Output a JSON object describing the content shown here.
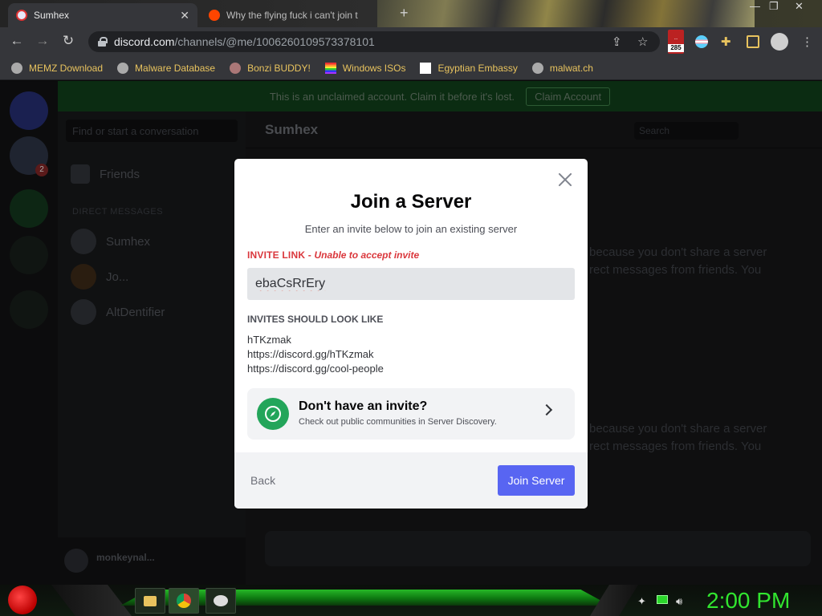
{
  "browser": {
    "tabs": [
      {
        "title": "Sumhex",
        "active": true
      },
      {
        "title": "Why the flying fuck i can't join t",
        "active": false
      }
    ],
    "url_host": "discord.com",
    "url_path": "/channels/@me/1006260109573378101",
    "extension_badge": "285",
    "bookmarks": [
      {
        "label": "MEMZ Download"
      },
      {
        "label": "Malware Database"
      },
      {
        "label": "Bonzi BUDDY!"
      },
      {
        "label": "Windows ISOs"
      },
      {
        "label": "Egyptian Embassy"
      },
      {
        "label": "malwat.ch"
      }
    ]
  },
  "discord": {
    "banner_text": "This is an unclaimed account. Claim it before it's lost.",
    "banner_button": "Claim Account",
    "search_placeholder": "Find or start a conversation",
    "friends_label": "Friends",
    "dm_header": "DIRECT MESSAGES",
    "dms": [
      {
        "name": "Sumhex"
      },
      {
        "name": "Jo..."
      },
      {
        "name": "AltDentifier"
      }
    ],
    "chat_title": "Sumhex",
    "header_search": "Search",
    "ghost_lines": [
      "because you don't share a server",
      "rect messages from friends. You"
    ],
    "username": "monkeynal...",
    "guild_badge": "2"
  },
  "modal": {
    "title": "Join a Server",
    "subtitle": "Enter an invite below to join an existing server",
    "invite_label": "INVITE LINK",
    "invite_sep": " - ",
    "invite_error": "Unable to accept invite",
    "invite_value": "ebaCsRrEry",
    "examples_heading": "INVITES SHOULD LOOK LIKE",
    "examples": [
      "hTKzmak",
      "https://discord.gg/hTKzmak",
      "https://discord.gg/cool-people"
    ],
    "discover_title": "Don't have an invite?",
    "discover_sub": "Check out public communities in Server Discovery.",
    "back_label": "Back",
    "join_label": "Join Server"
  },
  "taskbar": {
    "clock": "2:00 PM"
  },
  "colors": {
    "brand": "#5865f2",
    "danger": "#da373c",
    "discovery_green": "#23a55a",
    "clock_green": "#31e52f"
  }
}
